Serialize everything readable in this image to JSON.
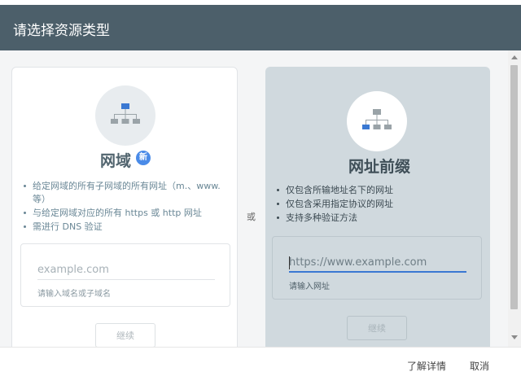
{
  "header": {
    "title": "请选择资源类型"
  },
  "domain_card": {
    "icon": "sitemap-icon",
    "title": "网域",
    "badge": "新",
    "features": [
      "给定网域的所有子网域的所有网址（m.、www. 等）",
      "与给定网域对应的所有 https 或 http 网址",
      "需进行 DNS 验证"
    ],
    "input_placeholder": "example.com",
    "helper": "请输入域名或子域名",
    "continue_label": "继续"
  },
  "or_label": "或",
  "prefix_card": {
    "icon": "sitemap-icon",
    "title": "网址前缀",
    "features": [
      "仅包含所输地址名下的网址",
      "仅包含采用指定协议的网址",
      "支持多种验证方法"
    ],
    "input_placeholder": "https://www.example.com",
    "helper": "请输入网址",
    "continue_label": "继续"
  },
  "footer": {
    "learn_more": "了解详情",
    "cancel": "取消"
  },
  "colors": {
    "header_bg": "#4c5f6a",
    "accent_blue": "#4a8be8",
    "selected_card_bg": "#d0d9de"
  }
}
